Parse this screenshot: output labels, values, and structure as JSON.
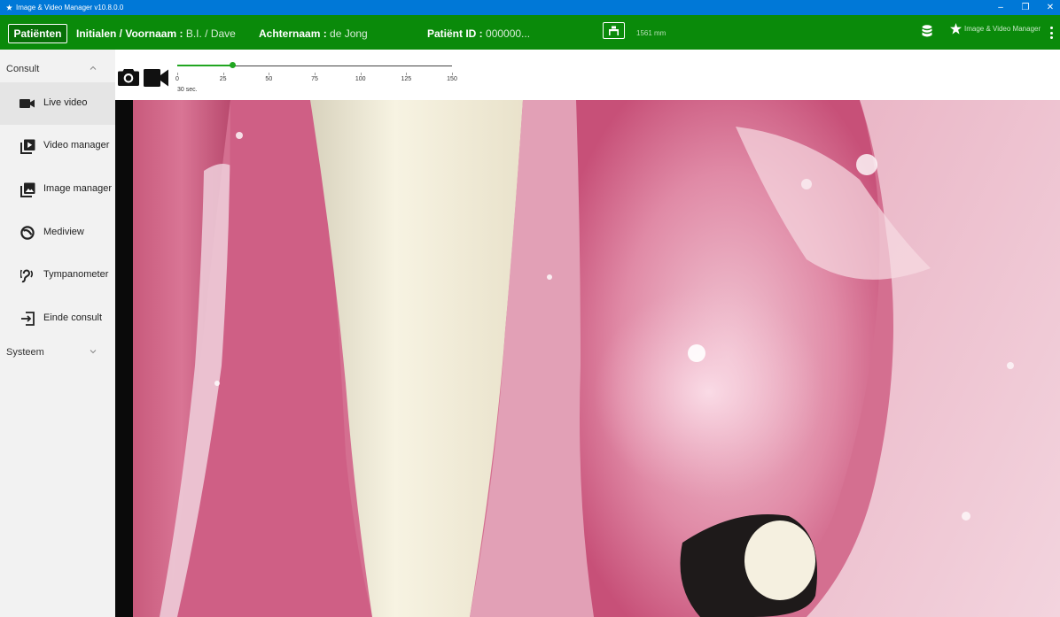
{
  "window": {
    "title": "Image & Video Manager v10.8.0.0",
    "controls": {
      "minimize": "–",
      "maximize": "❐",
      "close": "✕"
    }
  },
  "header": {
    "patients_button": "Patiënten",
    "initials_label": "Initialen / Voornaam :",
    "initials_value": "B.I. / Dave",
    "lastname_label": "Achternaam :",
    "lastname_value": "de Jong",
    "patient_id_label": "Patiënt ID :",
    "patient_id_value": "000000...",
    "distance_value": "1561 mm",
    "brand_label": "Image & Video Manager",
    "accent_color": "#0a8a0a",
    "icons": [
      "bed-icon",
      "database-icon",
      "star-icon",
      "kebab-menu-icon"
    ]
  },
  "sidebar": {
    "sections": [
      {
        "label": "Consult",
        "state": "expanded"
      },
      {
        "label": "Systeem",
        "state": "collapsed"
      }
    ],
    "items": [
      {
        "label": "Live video",
        "icon": "video-camera-icon",
        "active": true
      },
      {
        "label": "Video manager",
        "icon": "play-library-icon",
        "active": false
      },
      {
        "label": "Image manager",
        "icon": "image-library-icon",
        "active": false
      },
      {
        "label": "Mediview",
        "icon": "mediview-icon",
        "active": false
      },
      {
        "label": "Tympanometer",
        "icon": "ear-icon",
        "active": false
      },
      {
        "label": "Einde consult",
        "icon": "exit-icon",
        "active": false
      }
    ]
  },
  "toolbar": {
    "icons": [
      "photo-camera-icon",
      "video-record-icon"
    ],
    "slider": {
      "min": 0,
      "max": 150,
      "value": 30,
      "ticks": [
        "0",
        "25",
        "50",
        "75",
        "100",
        "125",
        "150"
      ],
      "value_label": "30 sec.",
      "color": "#21a621"
    }
  }
}
